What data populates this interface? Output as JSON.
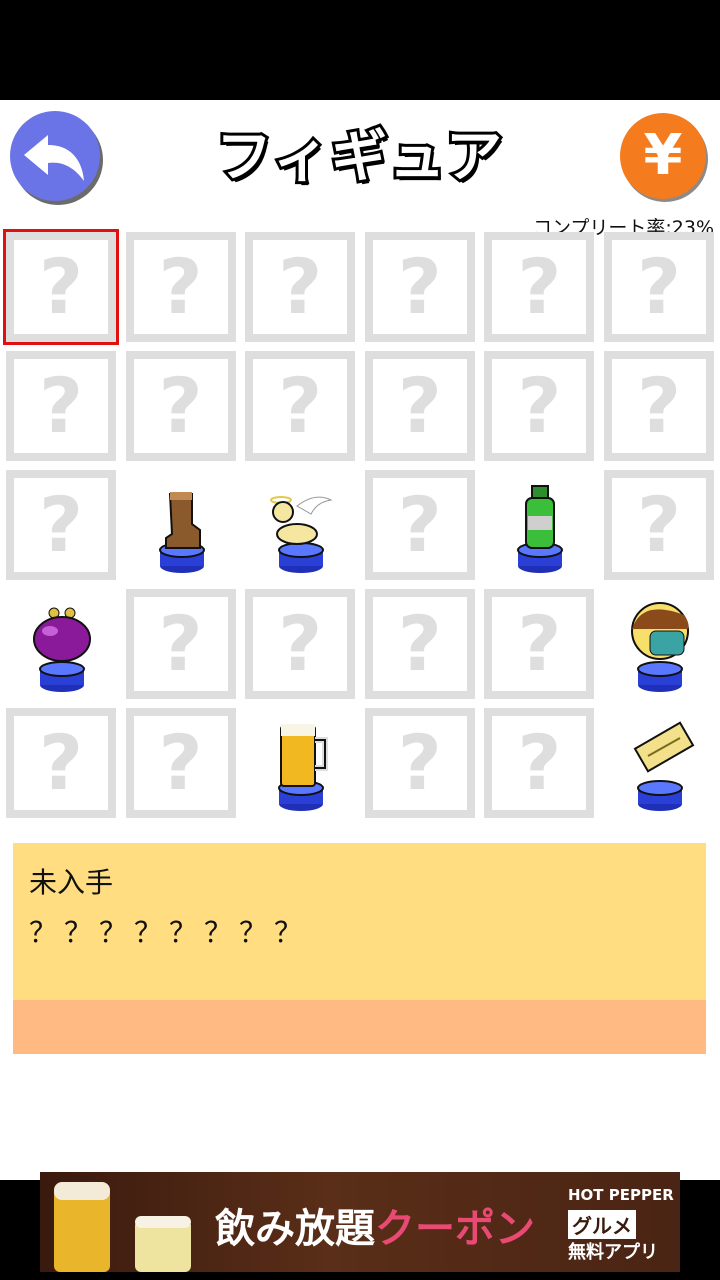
{
  "header": {
    "title": "フィギュア",
    "back_icon": "back-arrow-icon",
    "shop_label": "¥"
  },
  "completion": {
    "text": "コンプリート率:23%"
  },
  "grid": {
    "columns": 6,
    "rows": 5,
    "placeholder": "?",
    "selected_index": 0,
    "cells": [
      "?",
      "?",
      "?",
      "?",
      "?",
      "?",
      "?",
      "?",
      "?",
      "?",
      "?",
      "?",
      "?",
      "boot",
      "angel-dog",
      "?",
      "green-bottle",
      "?",
      "purple-purse",
      "?",
      "?",
      "?",
      "?",
      "masked-boy",
      "?",
      "?",
      "beer-mug",
      "?",
      "?",
      "ticket"
    ]
  },
  "info": {
    "status": "未入手",
    "name": "？？？？？？？？"
  },
  "ad": {
    "text_main": "飲み放題",
    "text_accent": "クーポン",
    "brand_top": "HOT PEPPER",
    "brand_mid": "グルメ",
    "brand_bottom": "無料アプリ"
  },
  "colors": {
    "back_button": "#6a74e6",
    "shop_button": "#f47c1e",
    "info_panel": "#ffdd80",
    "info_footer": "#ffb982",
    "selection": "#e01010"
  }
}
